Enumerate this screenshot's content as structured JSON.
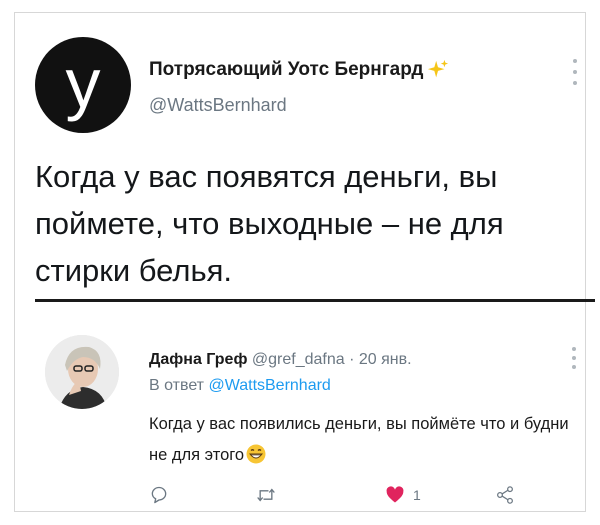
{
  "main_tweet": {
    "display_name": "Потрясающий Уотс Бернгард",
    "handle": "@WattsBernhard",
    "avatar_letter": "у",
    "text": "Когда у вас появятся деньги, вы поймете, что выходные – не для стирки белья."
  },
  "reply": {
    "display_name": "Дафна Греф",
    "handle": "@gref_dafna",
    "separator": "·",
    "date": "20 янв.",
    "replying_to_label": "В ответ",
    "replying_to_handle": "@WattsBernhard",
    "text": "Когда у вас появились деньги, вы поймёте что и будни не для этого",
    "likes_count": "1"
  },
  "colors": {
    "accent": "#1d9bf0",
    "like_red": "#e0245e",
    "sparkle_yellow": "#f5c518",
    "muted": "#6b7782"
  },
  "icons": {
    "reply": "speech-bubble",
    "retweet": "retweet-arrows",
    "like": "heart-filled",
    "share": "share-nodes",
    "more": "vertical-ellipsis",
    "badge": "sparkles",
    "emoji": "grinning-face"
  }
}
